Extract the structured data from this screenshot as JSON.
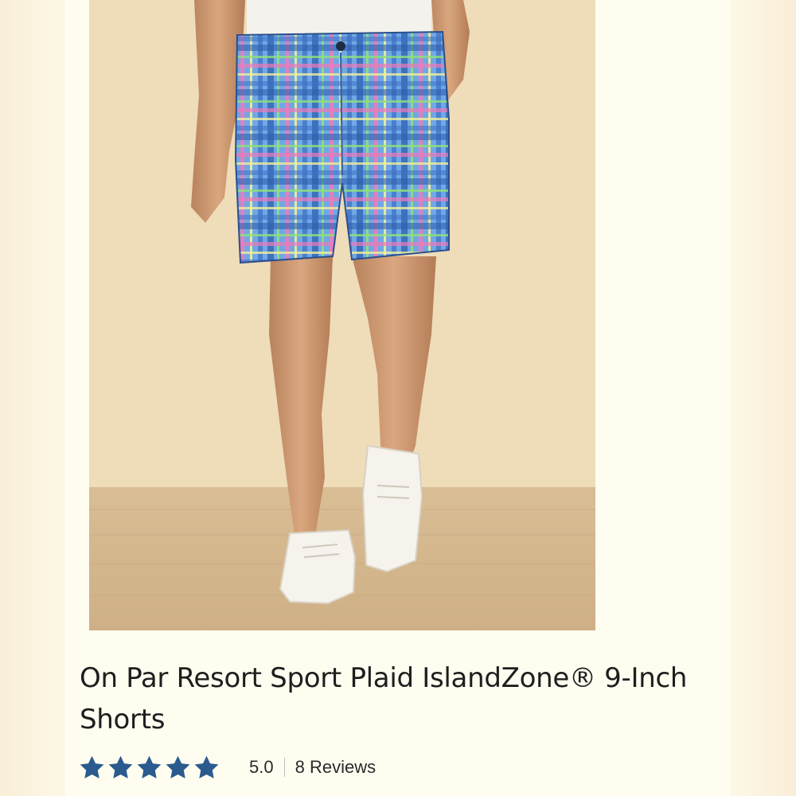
{
  "product": {
    "title": "On Par Resort Sport Plaid IslandZone® 9-Inch Shorts",
    "image_subject": "model wearing blue plaid shorts with white sneakers"
  },
  "rating": {
    "value": "5.0",
    "stars": 5,
    "star_icon": "star-icon",
    "reviews_label": "8 Reviews"
  },
  "colors": {
    "star": "#2b5b8e",
    "background": "#fdf8e6",
    "title_text": "#1e1e1e"
  }
}
